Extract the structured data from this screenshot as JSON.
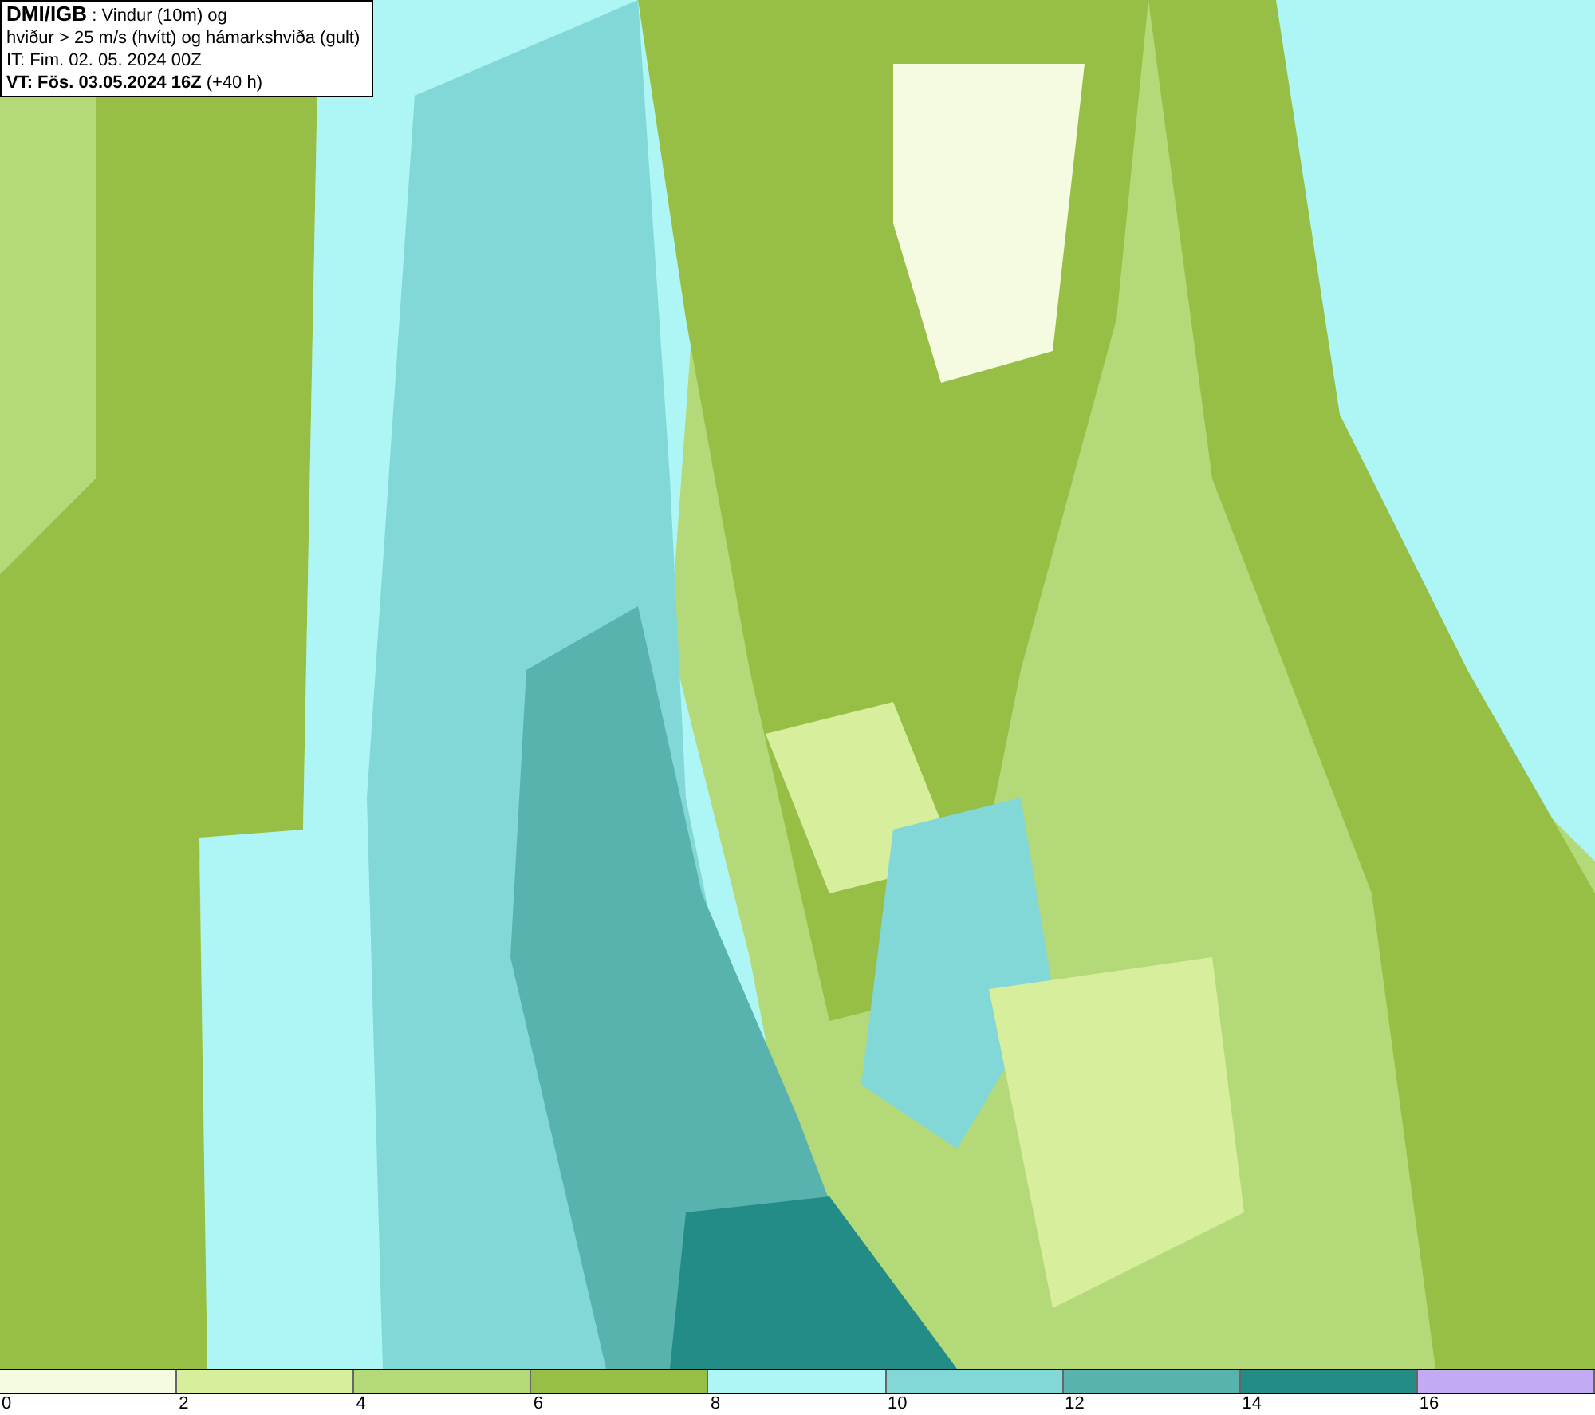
{
  "header": {
    "source": "DMI/IGB",
    "title_rest": " : Vindur (10m) og",
    "line_2": "hviður > 25 m/s (hvítt) og hámarkshviða (gult)",
    "line_3": "IT: Fim. 02. 05. 2024 00Z",
    "line_4_bold": "VT: Fös. 03.05.2024 16Z",
    "line_4_rest": " (+40 h)"
  },
  "legend": [
    {
      "label": "0",
      "color": "#f5fbe0"
    },
    {
      "label": "2",
      "color": "#d7ee9c"
    },
    {
      "label": "4",
      "color": "#b4d978"
    },
    {
      "label": "6",
      "color": "#97bf45"
    },
    {
      "label": "8",
      "color": "#aef6f6"
    },
    {
      "label": "10",
      "color": "#82d8d6"
    },
    {
      "label": "12",
      "color": "#58b2ae"
    },
    {
      "label": "14",
      "color": "#238c87"
    },
    {
      "label": "16",
      "color": "#c3aaf5"
    }
  ]
}
